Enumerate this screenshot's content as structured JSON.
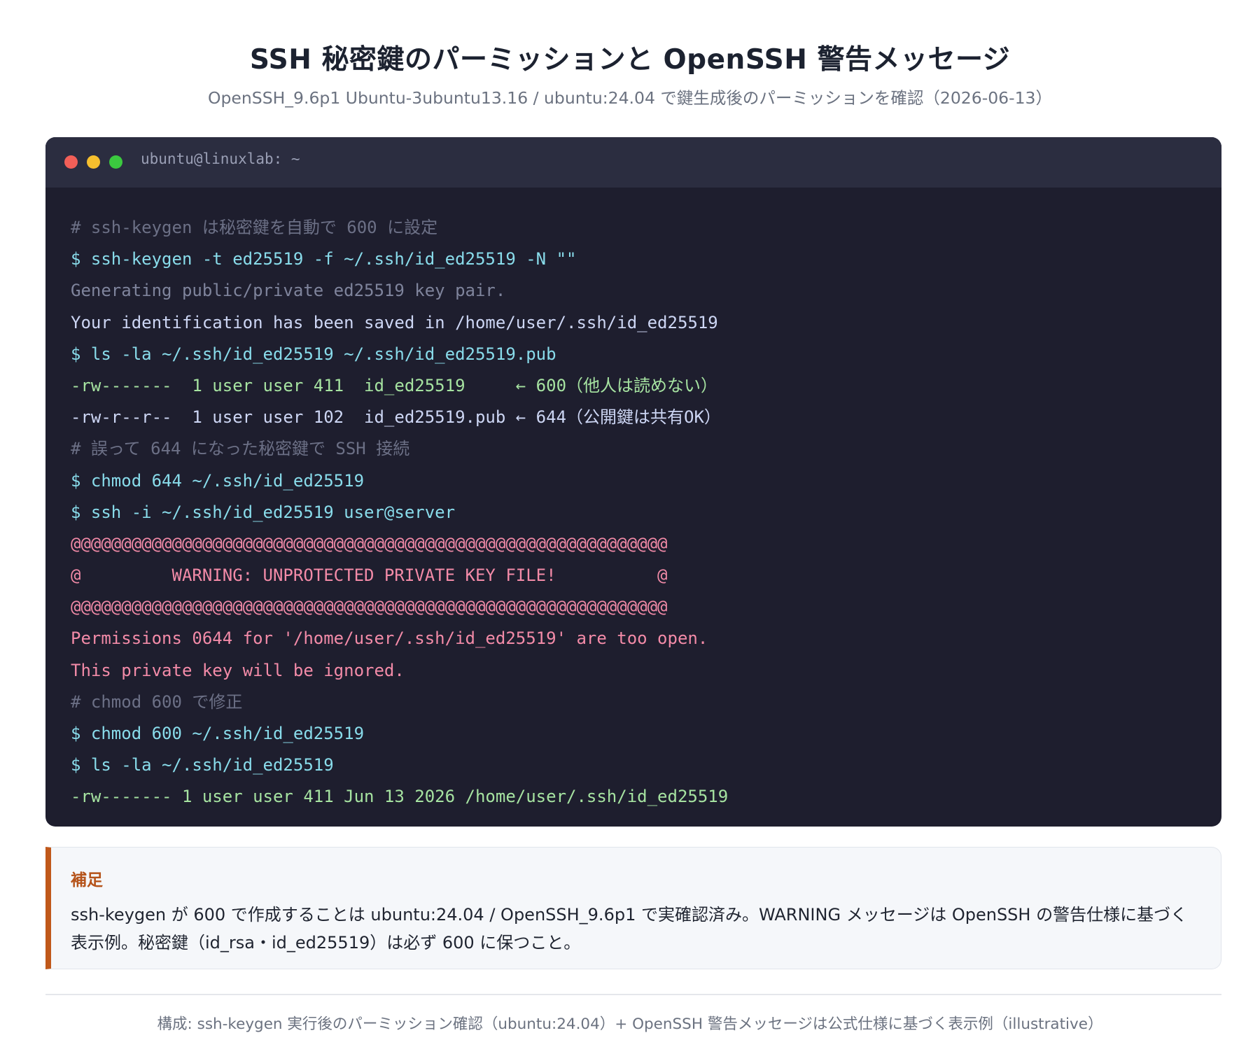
{
  "header": {
    "title": "SSH 秘密鍵のパーミッションと OpenSSH 警告メッセージ",
    "subtitle": "OpenSSH_9.6p1 Ubuntu-3ubuntu13.16 / ubuntu:24.04 で鍵生成後のパーミッションを確認（2026-06-13）"
  },
  "terminal": {
    "title": "ubuntu@linuxlab: ~",
    "lines": [
      {
        "style": "comment",
        "text": "# ssh-keygen は秘密鍵を自動で 600 に設定"
      },
      {
        "style": "cmd",
        "text": "$ ssh-keygen -t ed25519 -f ~/.ssh/id_ed25519 -N \"\""
      },
      {
        "style": "muted",
        "text": "Generating public/private ed25519 key pair."
      },
      {
        "style": "out",
        "text": "Your identification has been saved in /home/user/.ssh/id_ed25519"
      },
      {
        "style": "cmd",
        "text": "$ ls -la ~/.ssh/id_ed25519 ~/.ssh/id_ed25519.pub"
      },
      {
        "style": "green",
        "text": "-rw-------  1 user user 411  id_ed25519     ← 600（他人は読めない）"
      },
      {
        "style": "out",
        "text": "-rw-r--r--  1 user user 102  id_ed25519.pub ← 644（公開鍵は共有OK）"
      },
      {
        "style": "comment",
        "text": "# 誤って 644 になった秘密鍵で SSH 接続"
      },
      {
        "style": "cmd",
        "text": "$ chmod 644 ~/.ssh/id_ed25519"
      },
      {
        "style": "cmd",
        "text": "$ ssh -i ~/.ssh/id_ed25519 user@server"
      },
      {
        "style": "red",
        "text": "@@@@@@@@@@@@@@@@@@@@@@@@@@@@@@@@@@@@@@@@@@@@@@@@@@@@@@@@@@@"
      },
      {
        "style": "red",
        "text": "@         WARNING: UNPROTECTED PRIVATE KEY FILE!          @"
      },
      {
        "style": "red",
        "text": "@@@@@@@@@@@@@@@@@@@@@@@@@@@@@@@@@@@@@@@@@@@@@@@@@@@@@@@@@@@"
      },
      {
        "style": "red",
        "text": "Permissions 0644 for '/home/user/.ssh/id_ed25519' are too open."
      },
      {
        "style": "red",
        "text": "This private key will be ignored."
      },
      {
        "style": "comment",
        "text": "# chmod 600 で修正"
      },
      {
        "style": "cmd",
        "text": "$ chmod 600 ~/.ssh/id_ed25519"
      },
      {
        "style": "cmd",
        "text": "$ ls -la ~/.ssh/id_ed25519"
      },
      {
        "style": "green",
        "text": "-rw------- 1 user user 411 Jun 13 2026 /home/user/.ssh/id_ed25519"
      }
    ]
  },
  "note": {
    "title": "補足",
    "text": "ssh-keygen が 600 で作成することは ubuntu:24.04 / OpenSSH_9.6p1 で実確認済み。WARNING メッセージは OpenSSH の警告仕様に基づく表示例。秘密鍵（id_rsa・id_ed25519）は必ず 600 に保つこと。"
  },
  "footer": {
    "text": "構成: ssh-keygen 実行後のパーミッション確認（ubuntu:24.04）+ OpenSSH 警告メッセージは公式仕様に基づく表示例（illustrative）"
  },
  "colors": {
    "terminal_bg": "#1e1e2e",
    "titlebar_bg": "#2b2d40",
    "command": "#89dceb",
    "comment": "#6c7086",
    "success": "#a6e3a1",
    "warning": "#f38ba8",
    "note_accent": "#c0581a"
  }
}
